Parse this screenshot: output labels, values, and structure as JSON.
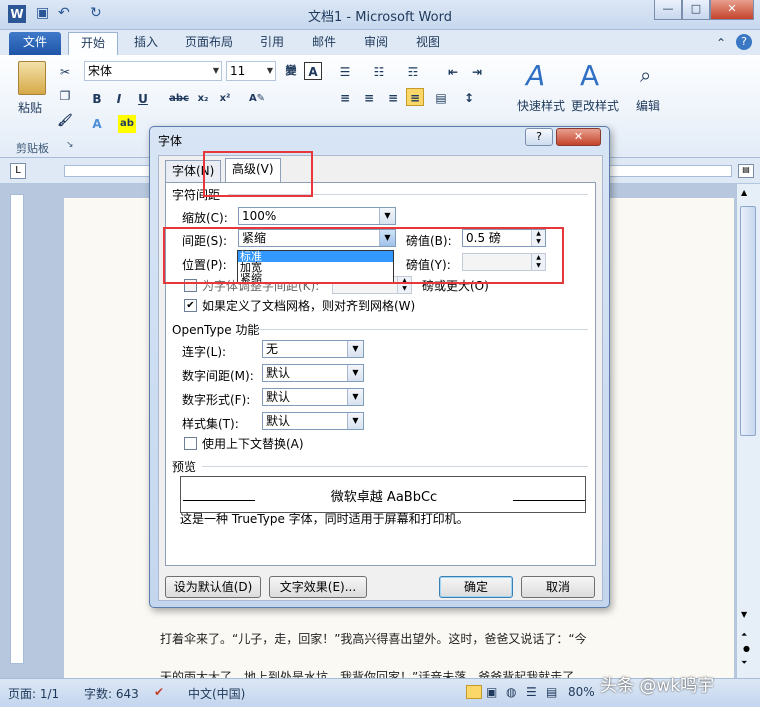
{
  "window": {
    "title": "文档1 - Microsoft Word",
    "app_icon": "W"
  },
  "tabs": [
    "文件",
    "开始",
    "插入",
    "页面布局",
    "引用",
    "邮件",
    "审阅",
    "视图"
  ],
  "ribbon": {
    "font_name": "宋体",
    "font_size": "11",
    "paste_label": "粘贴",
    "clipboard_label": "剪贴板",
    "quick_styles": "快速样式",
    "change_styles": "更改样式",
    "editing": "编辑"
  },
  "document": {
    "line1": "打着伞来了。“儿子，走，回家！”我高兴得喜出望外。这时，爸爸又说话了：“今",
    "line2": "天的雨太大了，地上到处是水坑，我背你回家！”话音未落，爸爸背起我就走了。"
  },
  "status": {
    "page": "页面: 1/1",
    "words": "字数: 643",
    "lang": "中文(中国)",
    "zoom": "80%"
  },
  "watermark": "头条 @wk鸣宇",
  "dialog": {
    "title": "字体",
    "tab_font": "字体(N)",
    "tab_advanced": "高级(V)",
    "section_spacing": "字符间距",
    "scale_label": "缩放(C):",
    "scale_value": "100%",
    "spacing_label": "间距(S):",
    "spacing_value": "紧缩",
    "spacing_by_label": "磅值(B):",
    "spacing_by_value": "0.5 磅",
    "position_label": "位置(P):",
    "position_by_label": "磅值(Y):",
    "dropdown_options": [
      "标准",
      "加宽",
      "紧缩"
    ],
    "kerning_label": "为字体调整字间距(K):",
    "kerning_unit": "磅或更大(O)",
    "grid_label": "如果定义了文档网格，则对齐到网格(W)",
    "section_opentype": "OpenType 功能",
    "ligatures_label": "连字(L):",
    "ligatures_value": "无",
    "num_spacing_label": "数字间距(M):",
    "num_spacing_value": "默认",
    "num_forms_label": "数字形式(F):",
    "num_forms_value": "默认",
    "stylistic_label": "样式集(T):",
    "stylistic_value": "默认",
    "contextual_label": "使用上下文替换(A)",
    "section_preview": "预览",
    "preview_text": "微软卓越  AaBbCc",
    "preview_note": "这是一种 TrueType 字体，同时适用于屏幕和打印机。",
    "btn_default": "设为默认值(D)",
    "btn_effects": "文字效果(E)...",
    "btn_ok": "确定",
    "btn_cancel": "取消"
  }
}
